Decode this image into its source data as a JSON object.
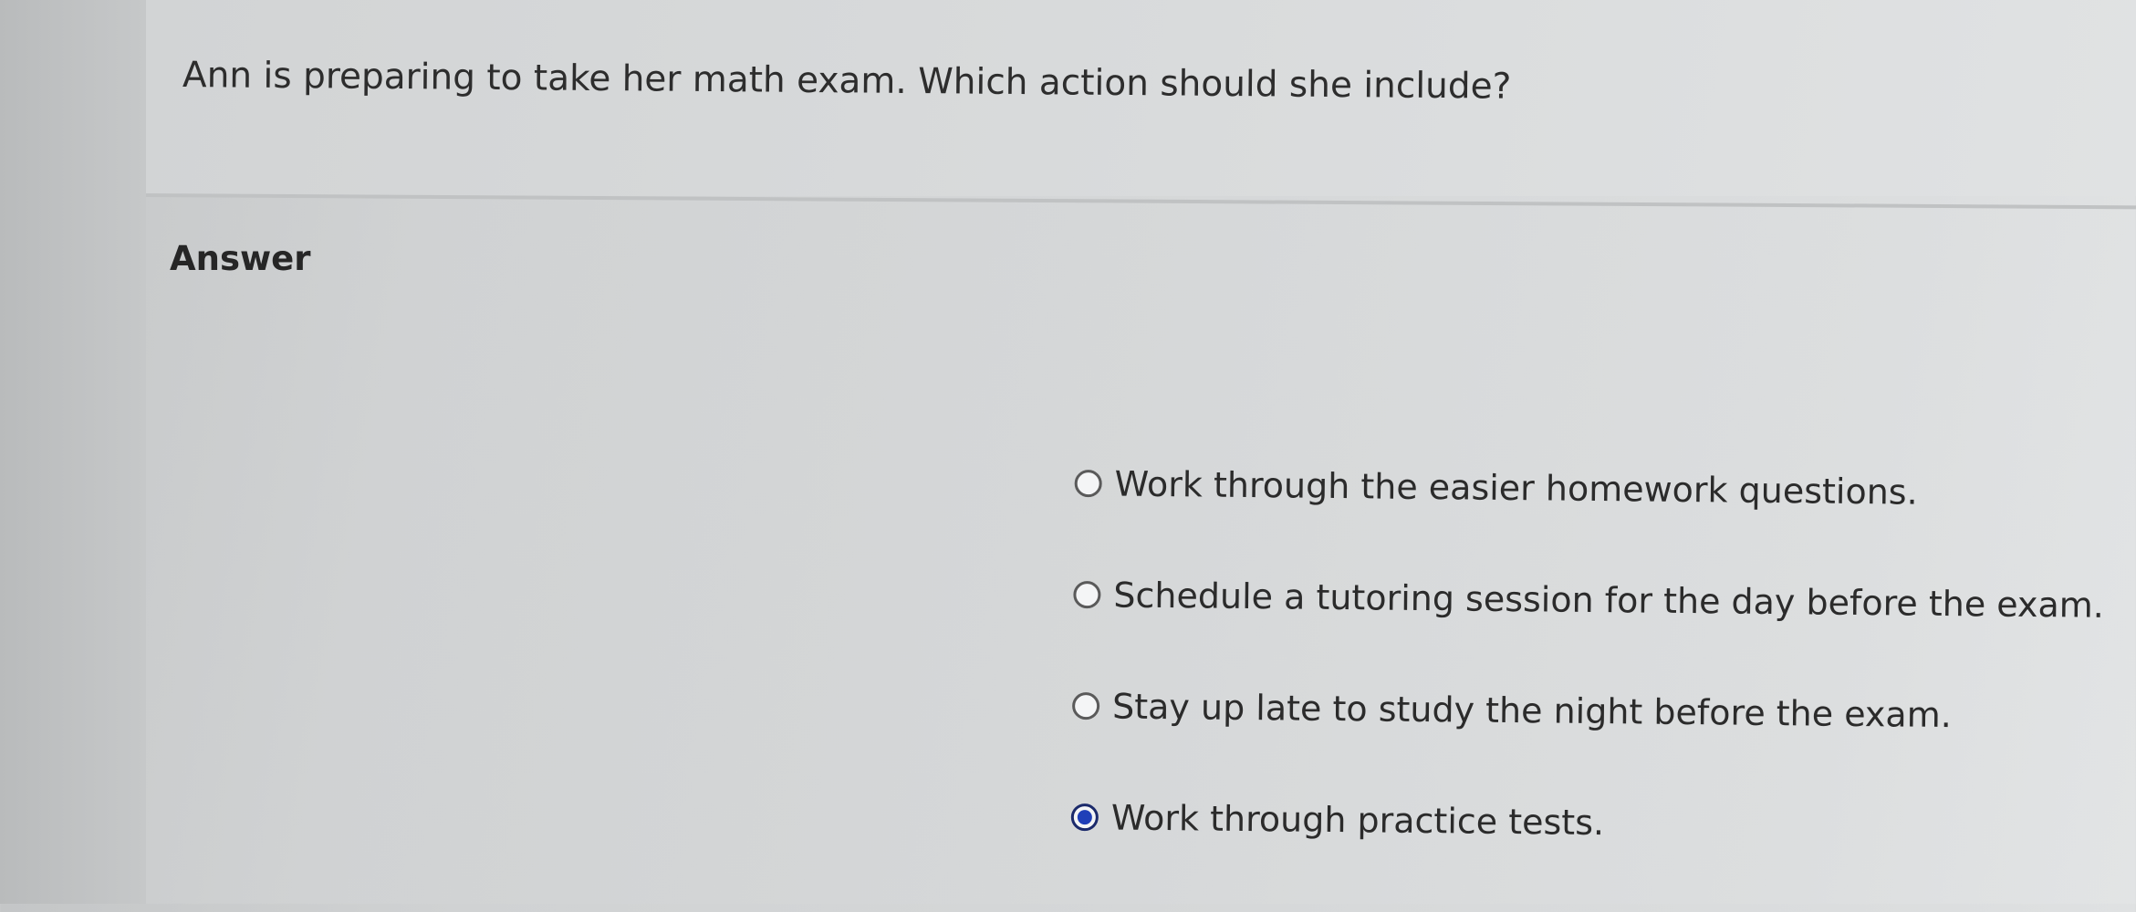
{
  "question": {
    "text": "Ann is preparing to take her math exam. Which action should she include?"
  },
  "answer": {
    "heading": "Answer",
    "options": [
      {
        "label": "Work through the easier homework questions.",
        "selected": false
      },
      {
        "label": "Schedule a tutoring session for the day before the exam.",
        "selected": false
      },
      {
        "label": "Stay up late to study the night before the exam.",
        "selected": false
      },
      {
        "label": "Work through practice tests.",
        "selected": true
      }
    ]
  },
  "colors": {
    "selected_radio": "#1f3fb8",
    "text": "#2b2b2b"
  }
}
